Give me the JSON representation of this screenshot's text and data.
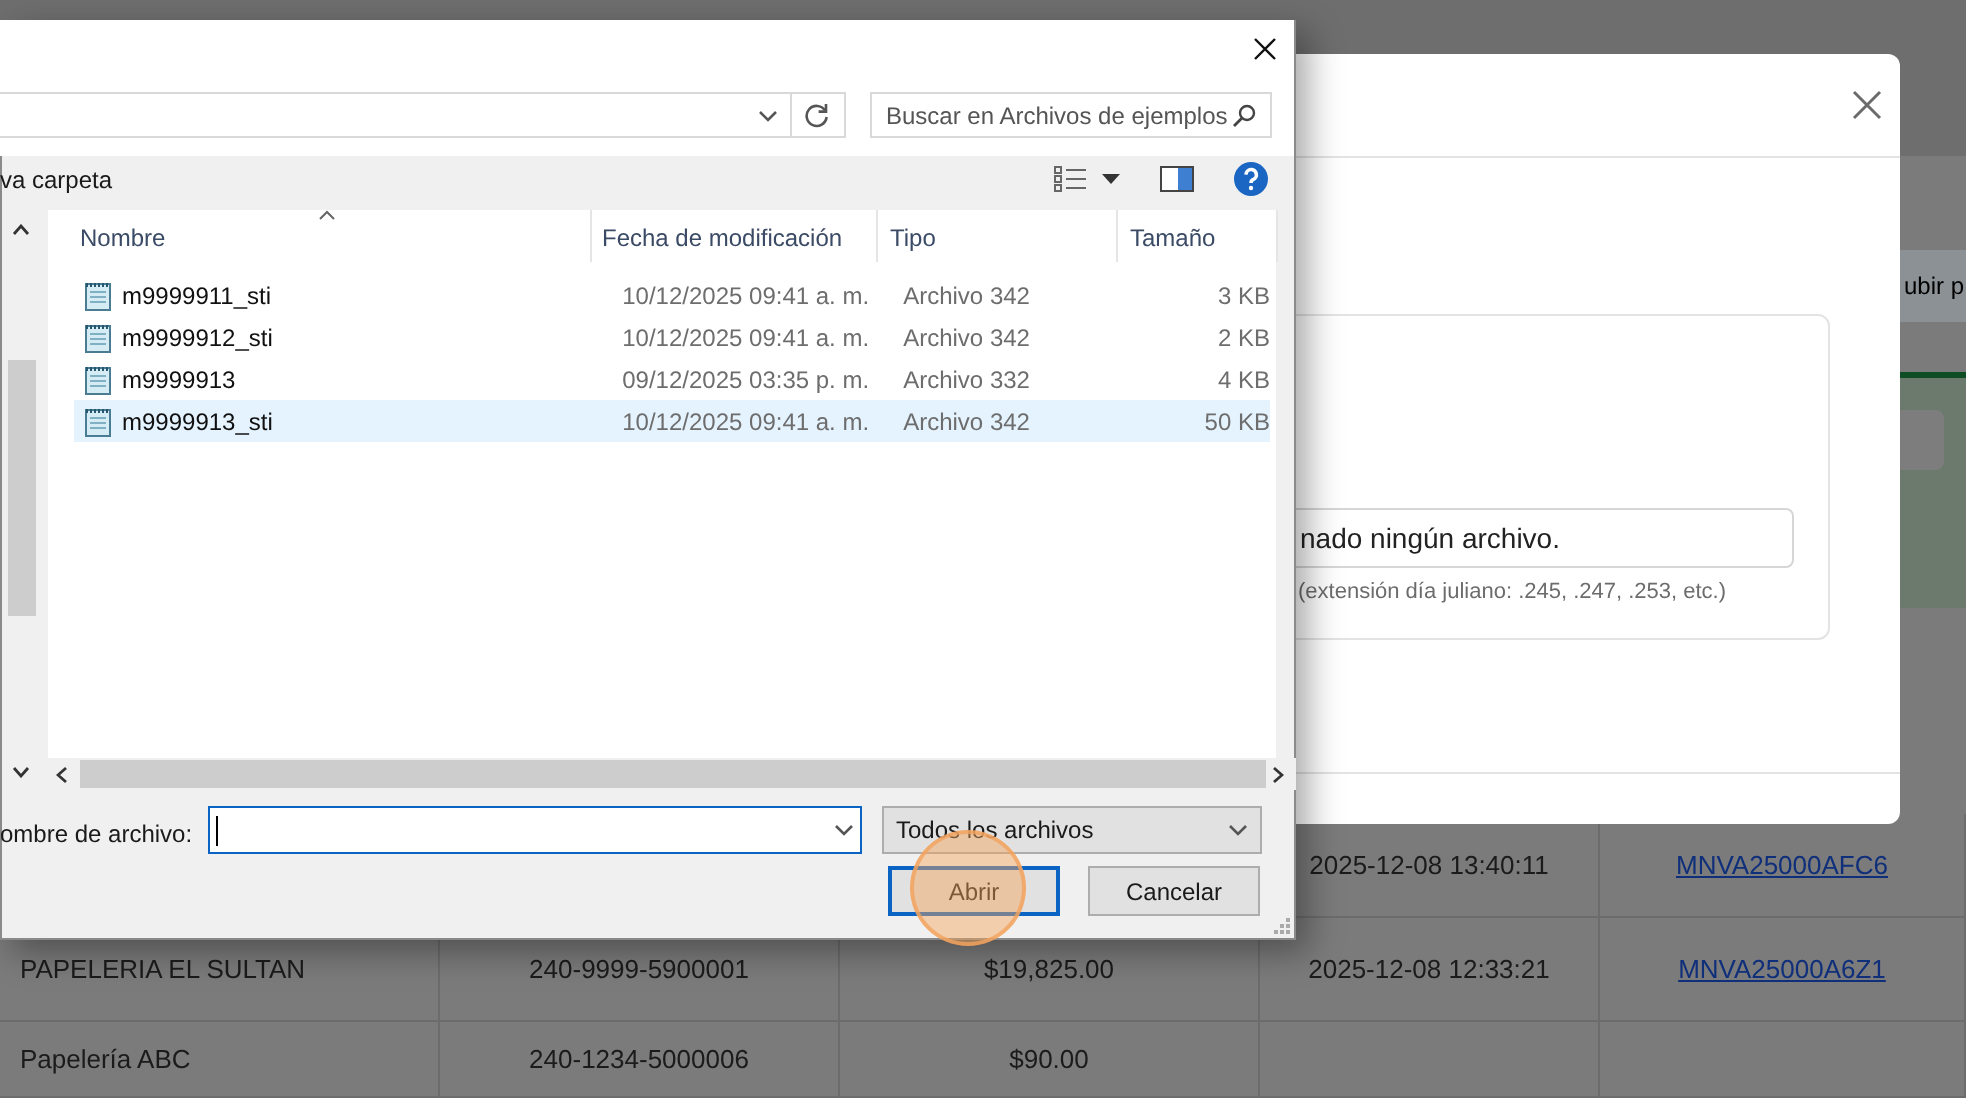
{
  "background": {
    "action_button": "ubir p",
    "table_rows": [
      {
        "date": "2025-12-08 13:40:11",
        "folio": "MNVA25000AFC6"
      },
      {
        "customer": "PAPELERIA EL SULTAN",
        "account": "240-9999-5900001",
        "amount": "$19,825.00",
        "date": "2025-12-08 12:33:21",
        "folio": "MNVA25000A6Z1"
      },
      {
        "customer": "Papelería ABC",
        "account": "240-1234-5000006",
        "amount": "$90.00"
      }
    ]
  },
  "upload_modal": {
    "file_field_text": "nado ningún archivo.",
    "hint": "(extensión día juliano: .245, .247, .253, etc.)"
  },
  "file_dialog": {
    "search": {
      "placeholder": "Buscar en Archivos de ejemplos"
    },
    "toolbar": {
      "new_folder": "va carpeta"
    },
    "columns": [
      "Nombre",
      "Fecha de modificación",
      "Tipo",
      "Tamaño"
    ],
    "files": [
      {
        "name": "m9999911_sti",
        "modified": "10/12/2025 09:41 a. m.",
        "type": "Archivo 342",
        "size": "3 KB",
        "selected": false
      },
      {
        "name": "m9999912_sti",
        "modified": "10/12/2025 09:41 a. m.",
        "type": "Archivo 342",
        "size": "2 KB",
        "selected": false
      },
      {
        "name": "m9999913",
        "modified": "09/12/2025 03:35 p. m.",
        "type": "Archivo 332",
        "size": "4 KB",
        "selected": false
      },
      {
        "name": "m9999913_sti",
        "modified": "10/12/2025 09:41 a. m.",
        "type": "Archivo 342",
        "size": "50 KB",
        "selected": true
      }
    ],
    "file_name_label": "ombre de archivo:",
    "file_type_filter": "Todos los archivos",
    "buttons": [
      "Abrir",
      "Cancelar"
    ]
  }
}
